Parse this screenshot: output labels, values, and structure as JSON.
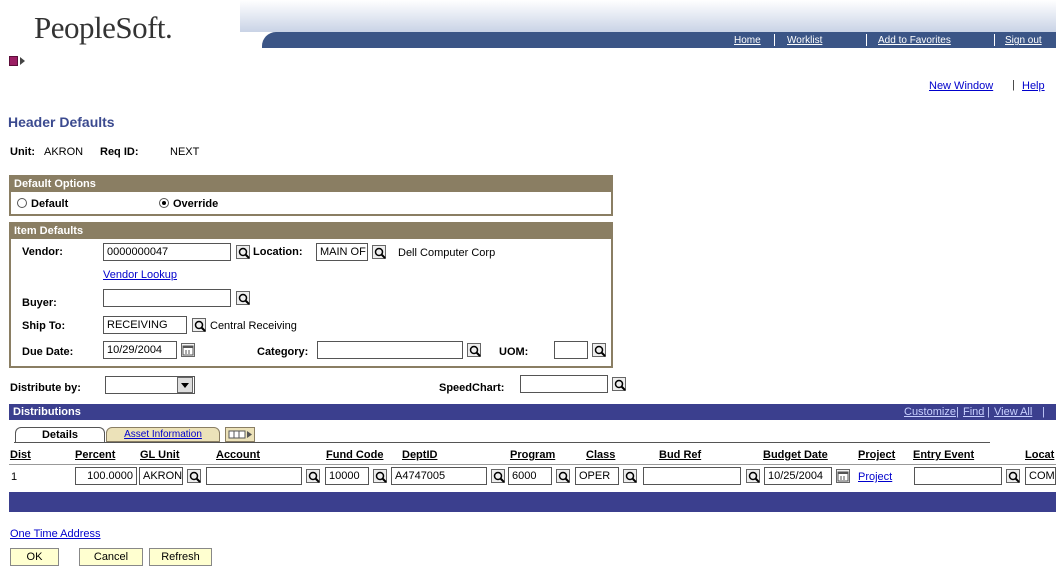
{
  "brand": {
    "name": "PeopleSoft."
  },
  "nav": {
    "home": "Home",
    "worklist": "Worklist",
    "add_favorites": "Add to Favorites",
    "sign_out": "Sign out"
  },
  "utility": {
    "new_window": "New Window",
    "help": "Help"
  },
  "page": {
    "title": "Header Defaults"
  },
  "header_info": {
    "unit_label": "Unit:",
    "unit_value": "AKRON",
    "req_label": "Req ID:",
    "req_value": "NEXT"
  },
  "default_options": {
    "title": "Default Options",
    "default_label": "Default",
    "override_label": "Override",
    "selected": "Override"
  },
  "item_defaults": {
    "title": "Item Defaults",
    "vendor_label": "Vendor:",
    "vendor_value": "0000000047",
    "location_label": "Location:",
    "location_value": "MAIN OF",
    "vendor_name": "Dell Computer Corp",
    "vendor_lookup": "Vendor Lookup",
    "buyer_label": "Buyer:",
    "buyer_value": "",
    "ship_to_label": "Ship To:",
    "ship_to_value": "RECEIVING",
    "ship_to_desc": "Central Receiving",
    "due_date_label": "Due Date:",
    "due_date_value": "10/29/2004",
    "category_label": "Category:",
    "category_value": "",
    "uom_label": "UOM:",
    "uom_value": ""
  },
  "distribute": {
    "label": "Distribute by:",
    "value": "",
    "speedchart_label": "SpeedChart:",
    "speedchart_value": ""
  },
  "distributions": {
    "title": "Distributions",
    "customize": "Customize",
    "find": "Find",
    "view_all": "View All",
    "tabs": [
      "Details",
      "Asset Information"
    ],
    "columns": [
      "Dist",
      "Percent",
      "GL Unit",
      "Account",
      "Fund Code",
      "DeptID",
      "Program",
      "Class",
      "Bud Ref",
      "Budget Date",
      "Project",
      "Entry Event",
      "Locat"
    ],
    "row": {
      "dist": "1",
      "percent": "100.0000",
      "gl_unit": "AKRON",
      "account": "",
      "fund_code": "10000",
      "deptid": "A4747005",
      "program": "6000",
      "class": "OPER",
      "bud_ref": "",
      "budget_date": "10/25/2004",
      "project": "Project",
      "entry_event": "",
      "location": "COM"
    }
  },
  "footer": {
    "one_time_address": "One Time Address",
    "ok": "OK",
    "cancel": "Cancel",
    "refresh": "Refresh"
  },
  "colors": {
    "nav_blue": "#3b5586",
    "grid_header": "#3b3f8e",
    "box_border": "#8a7e63",
    "title_blue": "#3b4a8f",
    "button_bg": "#ffffd0"
  }
}
